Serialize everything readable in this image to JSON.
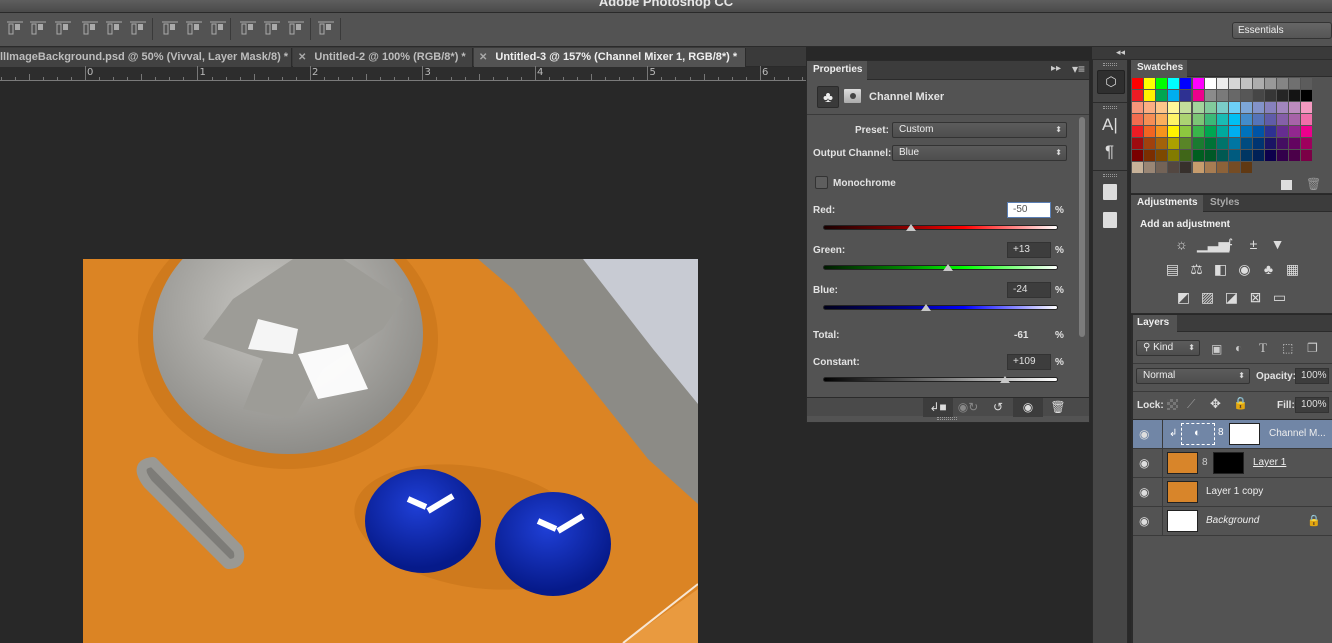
{
  "app": {
    "title": "Adobe Photoshop CC"
  },
  "optionsbar": {
    "align_icons": [
      "align-top-edges-icon",
      "align-vertical-centers-icon",
      "align-bottom-edges-icon",
      "align-left-edges-icon",
      "align-horizontal-centers-icon",
      "align-right-edges-icon",
      "distribute-top-icon",
      "distribute-vertical-centers-icon",
      "distribute-bottom-icon",
      "distribute-left-icon",
      "distribute-horizontal-centers-icon",
      "distribute-right-icon",
      "auto-align-layers-icon"
    ],
    "workspace": "Essentials"
  },
  "tabs": [
    {
      "label": "llImageBackground.psd @ 50% (Vivval, Layer Mask/8) *",
      "active": false
    },
    {
      "label": "Untitled-2 @ 100% (RGB/8*) *",
      "active": false
    },
    {
      "label": "Untitled-3 @ 157% (Channel Mixer 1, RGB/8*) *",
      "active": true
    }
  ],
  "ruler": {
    "labels": [
      "0",
      "1",
      "2",
      "3",
      "4",
      "5",
      "6"
    ]
  },
  "properties": {
    "tab": "Properties",
    "title": "Channel Mixer",
    "preset_label": "Preset:",
    "preset_value": "Custom",
    "output_label": "Output Channel:",
    "output_value": "Blue",
    "monochrome_label": "Monochrome",
    "monochrome_checked": false,
    "sliders": [
      {
        "label": "Red:",
        "value": "-50",
        "percent": -50,
        "range": [
          -200,
          200
        ]
      },
      {
        "label": "Green:",
        "value": "+13",
        "percent": 13,
        "range": [
          -200,
          200
        ]
      },
      {
        "label": "Blue:",
        "value": "-24",
        "percent": -24,
        "range": [
          -200,
          200
        ]
      }
    ],
    "total_label": "Total:",
    "total_value": "-61",
    "constant": {
      "label": "Constant:",
      "value": "+109",
      "percent": 109,
      "range": [
        -200,
        200
      ]
    },
    "pct": "%",
    "footer_icons": [
      "clip-to-layer-icon",
      "view-previous-state-icon",
      "reset-icon",
      "visibility-icon",
      "trash-icon"
    ]
  },
  "swatches": {
    "tab": "Swatches",
    "rows": [
      [
        "#ff0000",
        "#ffff00",
        "#00ff00",
        "#00ffff",
        "#0000ff",
        "#ff00ff",
        "#ffffff",
        "#ebebeb",
        "#d6d6d6",
        "#c2c2c2",
        "#adadad",
        "#999999",
        "#858585",
        "#707070",
        "#5c5c5c"
      ],
      [
        "#ed1c24",
        "#fff200",
        "#00a651",
        "#00aeef",
        "#2e3192",
        "#ec008c",
        "#8b8b8b",
        "#7a7a7a",
        "#686868",
        "#575757",
        "#464646",
        "#363636",
        "#252525",
        "#141414",
        "#000000"
      ],
      [
        "#f7977a",
        "#fbad82",
        "#fdc68a",
        "#fff799",
        "#c4df9b",
        "#a3d39c",
        "#82ca9c",
        "#7accc8",
        "#6dcff6",
        "#7da7d8",
        "#8393ca",
        "#8781bd",
        "#a186be",
        "#bd8cbf",
        "#f49ac1"
      ],
      [
        "#f26c4f",
        "#f68e55",
        "#fbaf5c",
        "#fff467",
        "#acd372",
        "#7cc576",
        "#3bb878",
        "#1abbb4",
        "#00bff3",
        "#438ccb",
        "#5574b9",
        "#605ca8",
        "#855fa8",
        "#a763a8",
        "#f06ea9"
      ],
      [
        "#ed1c24",
        "#f26522",
        "#f7941d",
        "#fff200",
        "#8dc73f",
        "#39b54a",
        "#00a651",
        "#00a99d",
        "#00aeef",
        "#0072bc",
        "#0054a6",
        "#2e3192",
        "#662d91",
        "#92278f",
        "#ec008c"
      ],
      [
        "#9e0b0f",
        "#a0410d",
        "#a3620a",
        "#aba000",
        "#598527",
        "#1a7b30",
        "#007236",
        "#00746b",
        "#0076a3",
        "#004b80",
        "#003471",
        "#1b1464",
        "#440e62",
        "#630460",
        "#9e005d"
      ],
      [
        "#790000",
        "#7b2e00",
        "#7d4900",
        "#827b00",
        "#406618",
        "#005e20",
        "#005826",
        "#005952",
        "#005b7f",
        "#003663",
        "#002157",
        "#0d004c",
        "#32004b",
        "#4b0049",
        "#7b0046"
      ],
      [
        "#c7b299",
        "#998675",
        "#736357",
        "#534741",
        "#37302c",
        "#c69c6d",
        "#a67c52",
        "#8c6239",
        "#754c24",
        "#603913"
      ]
    ]
  },
  "adjustments": {
    "tabs": [
      "Adjustments",
      "Styles"
    ],
    "heading": "Add an adjustment",
    "row1": [
      {
        "name": "brightness-contrast-icon",
        "glyph": "☼"
      },
      {
        "name": "levels-icon",
        "glyph": "▁▃▅"
      },
      {
        "name": "curves-icon",
        "glyph": "⨍"
      },
      {
        "name": "exposure-icon",
        "glyph": "±"
      },
      {
        "name": "vibrance-icon",
        "glyph": "▼"
      }
    ],
    "row2": [
      {
        "name": "hue-saturation-icon",
        "glyph": "▤"
      },
      {
        "name": "color-balance-icon",
        "glyph": "⚖"
      },
      {
        "name": "black-white-icon",
        "glyph": "◧"
      },
      {
        "name": "photo-filter-icon",
        "glyph": "◉"
      },
      {
        "name": "channel-mixer-icon",
        "glyph": "♣"
      },
      {
        "name": "color-lookup-icon",
        "glyph": "▦"
      }
    ],
    "row3": [
      {
        "name": "invert-icon",
        "glyph": "◩"
      },
      {
        "name": "posterize-icon",
        "glyph": "▨"
      },
      {
        "name": "threshold-icon",
        "glyph": "◪"
      },
      {
        "name": "selective-color-icon",
        "glyph": "⊠"
      },
      {
        "name": "gradient-map-icon",
        "glyph": "▭"
      }
    ]
  },
  "layers": {
    "tab": "Layers",
    "filter": "Kind",
    "blend_mode": "Normal",
    "opacity_label": "Opacity:",
    "opacity": "100%",
    "lock_label": "Lock:",
    "fill_label": "Fill:",
    "fill": "100%",
    "items": [
      {
        "name": "Channel M...",
        "type": "adjustment",
        "selected": true,
        "visible": true
      },
      {
        "name": "Layer 1",
        "type": "masked",
        "selected": false,
        "visible": true
      },
      {
        "name": "Layer 1 copy",
        "type": "pixel",
        "selected": false,
        "visible": true
      },
      {
        "name": "Background",
        "type": "background",
        "selected": false,
        "visible": true,
        "locked": true
      }
    ]
  }
}
